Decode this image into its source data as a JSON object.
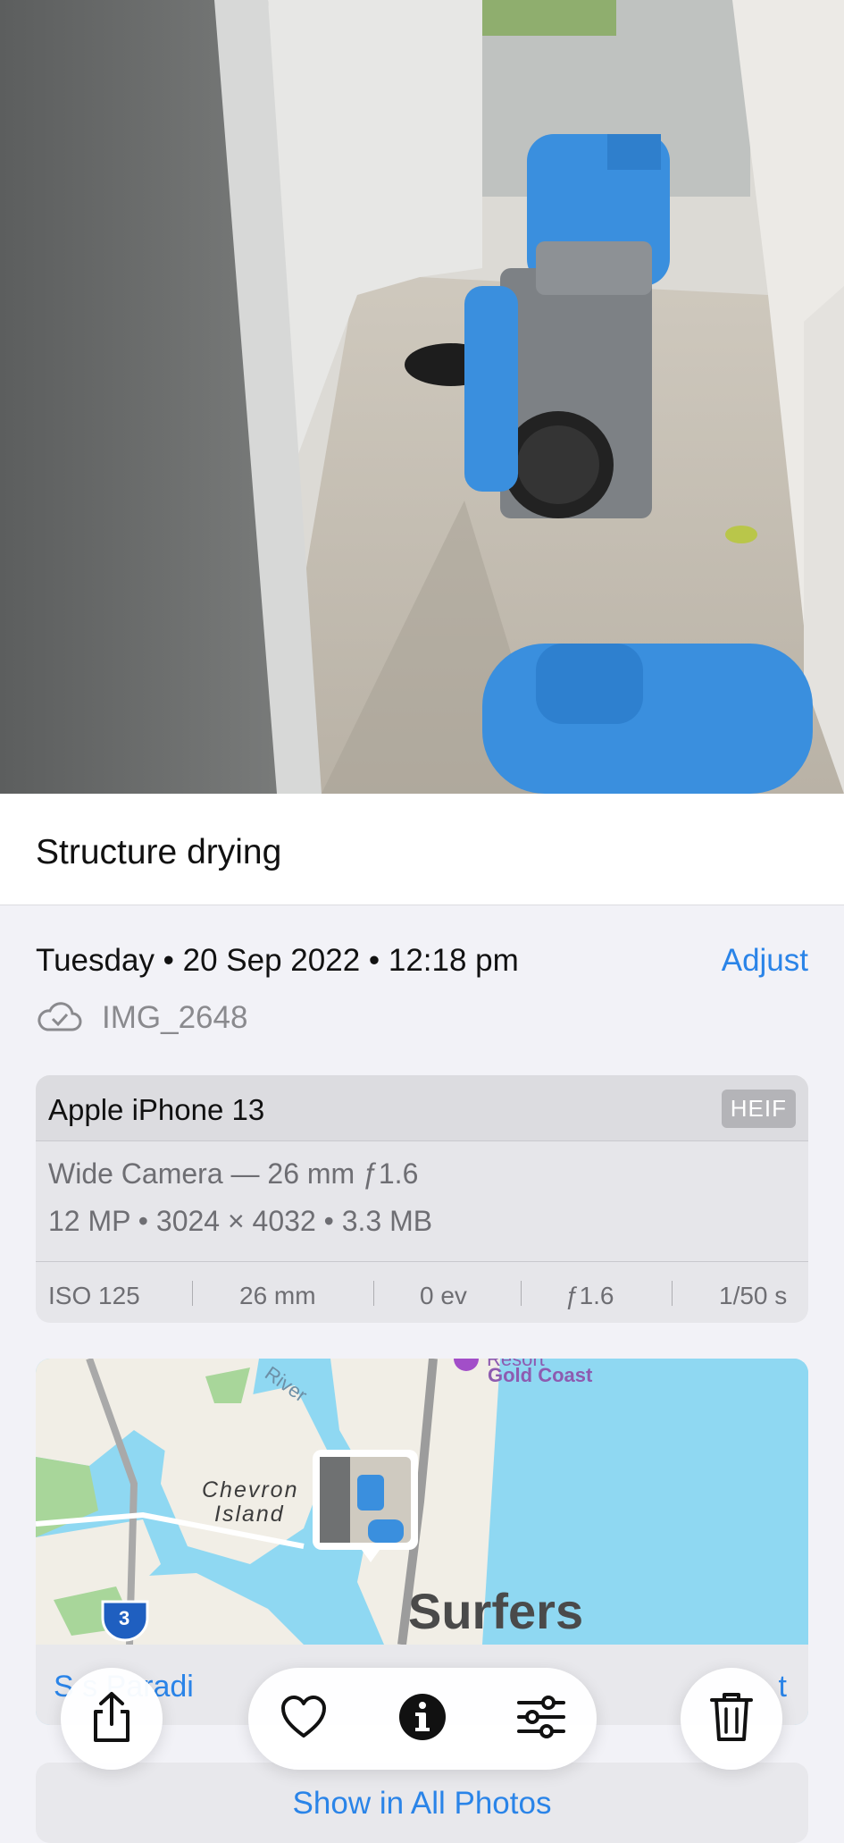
{
  "photo": {
    "alt_icon": "photo-image"
  },
  "caption": "Structure drying",
  "meta": {
    "date_time": "Tuesday • 20 Sep 2022 • 12:18 pm",
    "adjust_label": "Adjust",
    "filename": "IMG_2648"
  },
  "camera": {
    "device": "Apple iPhone 13",
    "format": "HEIF",
    "lens": "Wide Camera — 26 mm ƒ1.6",
    "specs": "12 MP • 3024 × 4032 • 3.3 MB",
    "exif": [
      "ISO 125",
      "26 mm",
      "0 ev",
      "ƒ1.6",
      "1/50 s"
    ]
  },
  "map": {
    "labels": {
      "river": "River",
      "resort": "Resort",
      "gold_coast": "Gold Coast",
      "island": "Chevron\nIsland",
      "surfers": "Surfers",
      "route": "3"
    },
    "location_left": "S       s Paradi",
    "location_right": "t"
  },
  "show_all_label": "Show in All Photos",
  "colors": {
    "accent": "#2a84e8",
    "blower": "#3a8fde",
    "water": "#8fd8f2"
  },
  "toolbar": {
    "share_icon": "share-icon",
    "favorite_icon": "heart-icon",
    "info_icon": "info-icon",
    "adjust_icon": "sliders-icon",
    "delete_icon": "trash-icon"
  }
}
